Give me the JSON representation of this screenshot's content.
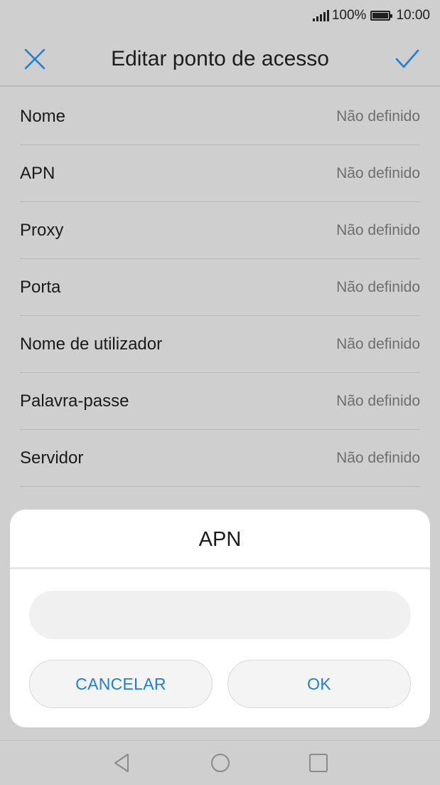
{
  "status_bar": {
    "battery": "100%",
    "time": "10:00",
    "battery_level": 1.0
  },
  "header": {
    "title": "Editar ponto de acesso",
    "close_icon": "close-icon",
    "confirm_icon": "check-icon",
    "accent_color": "#1e7fd6"
  },
  "settings": [
    {
      "label": "Nome",
      "value": "Não definido"
    },
    {
      "label": "APN",
      "value": "Não definido"
    },
    {
      "label": "Proxy",
      "value": "Não definido"
    },
    {
      "label": "Porta",
      "value": "Não definido"
    },
    {
      "label": "Nome de utilizador",
      "value": "Não definido"
    },
    {
      "label": "Palavra-passe",
      "value": "Não definido"
    },
    {
      "label": "Servidor",
      "value": "Não definido"
    }
  ],
  "dialog": {
    "title": "APN",
    "input_value": "",
    "cancel_label": "CANCELAR",
    "ok_label": "OK"
  },
  "nav_bar": {
    "icons": [
      "back-icon",
      "home-icon",
      "recents-icon"
    ]
  }
}
